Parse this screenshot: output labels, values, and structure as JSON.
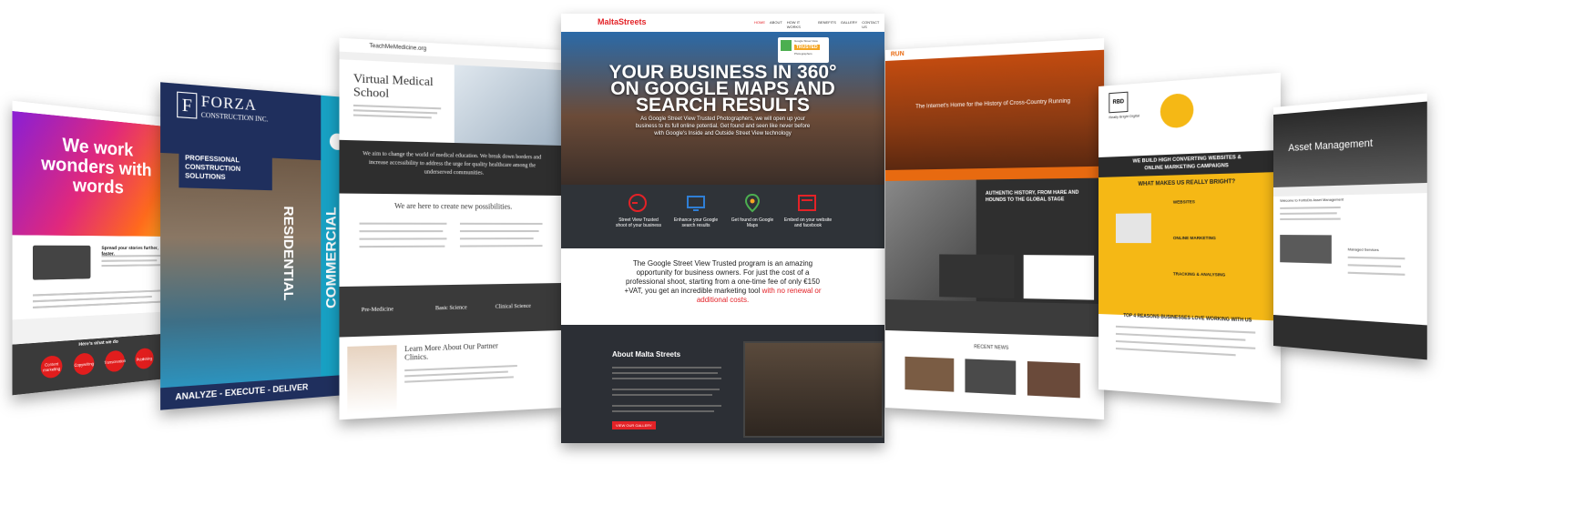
{
  "card1": {
    "headline": "We work wonders with words",
    "sub_heading": "Spread your stories further, faster.",
    "band_title": "Here's what we do",
    "services": [
      "Content marketing",
      "Copywriting",
      "Transcreation",
      "Publishing"
    ]
  },
  "card2": {
    "logo_letter": "F",
    "brand": "FORZA",
    "brand_sub": "CONSTRUCTION INC.",
    "badge": "PROFESSIONAL CONSTRUCTION SOLUTIONS",
    "vertical_labels": [
      "RESIDENTIAL",
      "COMMERCIAL"
    ],
    "tagline": "ANALYZE - EXECUTE - DELIVER"
  },
  "card3": {
    "logo": "TeachMeMedicine.org",
    "hero_title": "Virtual Medical School",
    "statement": "We aim to change the world of medical education. We break down borders and increase accessibility to address the urge for quality healthcare among the underserved communities.",
    "section_title": "We are here to create new possibilities.",
    "programs": [
      "Pre-Medicine",
      "Basic Science",
      "Clinical Science"
    ],
    "partner_title": "Learn More About Our Partner Clinics."
  },
  "card4": {
    "logo": "MaltaStreets",
    "nav": [
      "HOME",
      "ABOUT",
      "HOW IT WORKS",
      "BENEFITS",
      "GALLERY",
      "CONTACT US"
    ],
    "badge_top": "Google Street View",
    "badge_mid": "TRUSTED",
    "badge_bottom": "Photographers",
    "hero_line1": "YOUR BUSINESS IN 360°",
    "hero_line2": "ON GOOGLE MAPS AND",
    "hero_line3": "SEARCH RESULTS",
    "hero_body": "As Google Street View Trusted Photographers, we will open up your business to its full online potential. Get found and seen like never before with Google's Inside and Outside Street View technology",
    "features": [
      {
        "label": "Street View Trusted shoot of your business",
        "icon": "swirl-icon"
      },
      {
        "label": "Enhance your Google search results",
        "icon": "screen-icon"
      },
      {
        "label": "Get found on Google Maps",
        "icon": "map-pin-icon"
      },
      {
        "label": "Embed on your website and facebook",
        "icon": "embed-icon"
      }
    ],
    "program_text": "The Google Street View Trusted program is an amazing opportunity for business owners. For just the cost of a professional shoot, starting from a one-time fee of only €150 +VAT, you get an incredible marketing tool",
    "program_highlight": "with no renewal or additional costs.",
    "about_title": "About Malta Streets",
    "about_button": "VIEW OUR GALLERY",
    "accent": "#e32227"
  },
  "card5": {
    "logo": "RUN",
    "hero_title": "The Internet's Home for the History of Cross-Country Running",
    "mid_title": "AUTHENTIC HISTORY, FROM HARE AND HOUNDS TO THE GLOBAL STAGE",
    "recent_news": "RECENT NEWS"
  },
  "card6": {
    "logo": "RBD",
    "logo_sub": "Really Bright Digital",
    "band_line1": "WE BUILD HIGH CONVERTING WEBSITES &",
    "band_line2": "ONLINE MARKETING CAMPAIGNS",
    "question": "WHAT MAKES US REALLY BRIGHT?",
    "items": [
      "WEBSITES",
      "ONLINE MARKETING",
      "TRACKING & ANALYSING"
    ],
    "bottom_title": "TOP 4 REASONS BUSINESSES LOVE WORKING WITH US"
  },
  "card7": {
    "hero_title": "Asset Management",
    "welcome": "Welcome to FortisDis Asset Management",
    "services_title": "Managed Services"
  }
}
